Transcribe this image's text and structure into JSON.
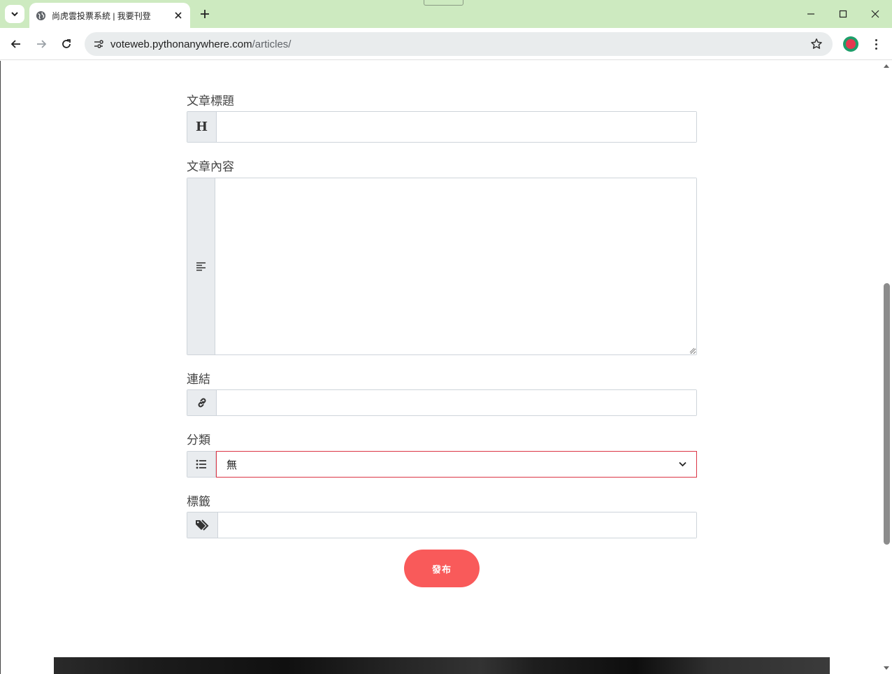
{
  "browser": {
    "tab_title": "尚虎雲投票系統 | 我要刊登",
    "url_host": "voteweb.pythonanywhere.com",
    "url_path": "/articles/",
    "accent_color": "#cdeac0"
  },
  "form": {
    "title_label": "文章標題",
    "title_icon_text": "H",
    "title_value": "",
    "content_label": "文章內容",
    "content_value": "",
    "link_label": "連結",
    "link_value": "",
    "category_label": "分類",
    "category_selected": "無",
    "tags_label": "標籤",
    "tags_value": "",
    "submit_label": "發布",
    "submit_color": "#f95a5a"
  }
}
